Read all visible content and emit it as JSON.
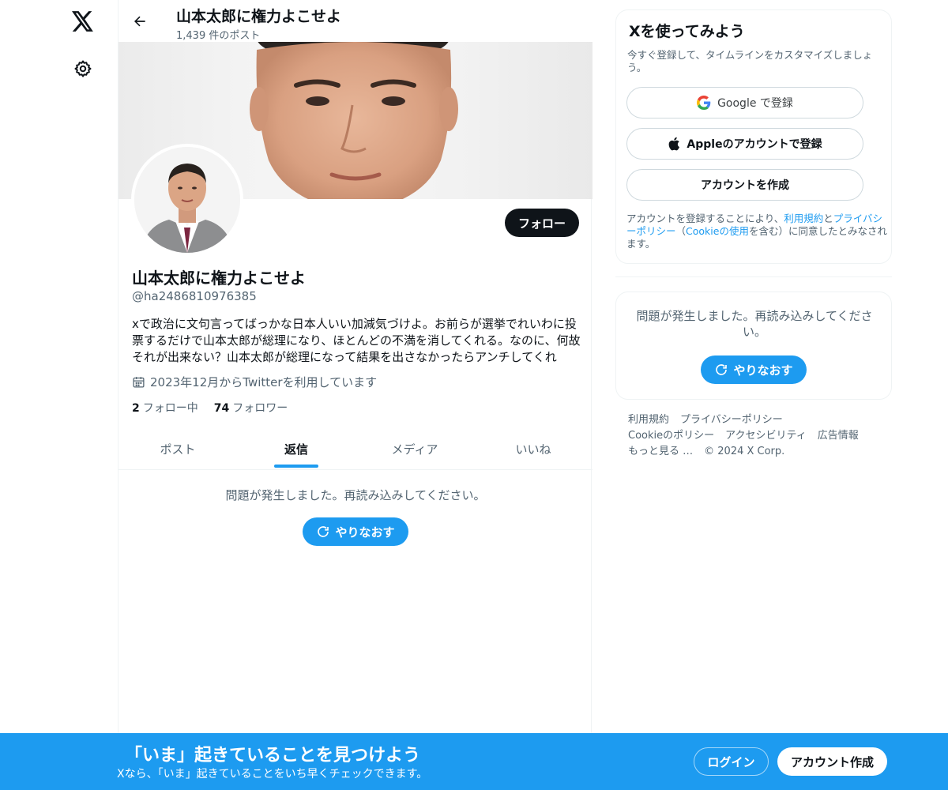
{
  "header": {
    "title": "山本太郎に権力よこせよ",
    "post_count": "1,439 件のポスト"
  },
  "profile": {
    "name": "山本太郎に権力よこせよ",
    "handle": "@ha2486810976385",
    "bio": "xで政治に文句言ってばっかな日本人いい加減気づけよ。お前らが選挙でれいわに投票するだけで山本太郎が総理になり、ほとんどの不満を消してくれる。なのに、何故それが出来ない？山本太郎が総理になって結果を出さなかったらアンチしてくれ",
    "joined": "2023年12月からTwitterを利用しています",
    "following_count": "2",
    "following_label": "フォロー中",
    "followers_count": "74",
    "followers_label": "フォロワー",
    "follow_label": "フォロー"
  },
  "tabs": [
    {
      "label": "ポスト",
      "active": false
    },
    {
      "label": "返信",
      "active": true
    },
    {
      "label": "メディア",
      "active": false
    },
    {
      "label": "いいね",
      "active": false
    }
  ],
  "feed": {
    "error_message": "問題が発生しました。再読み込みしてください。",
    "retry_label": "やりなおす"
  },
  "signup": {
    "title": "Xを使ってみよう",
    "description": "今すぐ登録して、タイムラインをカスタマイズしましょう。",
    "google_label": "Google で登録",
    "apple_label": "Appleのアカウントで登録",
    "create_label": "アカウントを作成",
    "legal_prefix": "アカウントを登録することにより、",
    "legal_terms": "利用規約",
    "legal_and": "と",
    "legal_privacy": "プライバシーポリシー",
    "legal_open": "（",
    "legal_cookie": "Cookieの使用",
    "legal_suffix": "を含む）に同意したとみなされます。"
  },
  "side_error": {
    "message": "問題が発生しました。再読み込みしてください。",
    "retry_label": "やりなおす"
  },
  "footer": {
    "links": [
      "利用規約",
      "プライバシーポリシー",
      "Cookieのポリシー",
      "アクセシビリティ",
      "広告情報",
      "もっと見る …"
    ],
    "copyright": "© 2024 X Corp."
  },
  "bottom_bar": {
    "headline": "「いま」起きていることを見つけよう",
    "subtext": "Xなら、「いま」起きていることをいち早くチェックできます。",
    "login_label": "ログイン",
    "create_label": "アカウント作成"
  },
  "colors": {
    "accent": "#1d9bf0",
    "text_primary": "#0f1419",
    "text_secondary": "#536471"
  },
  "icons": {
    "logo": "x-logo-icon",
    "settings": "gear-icon",
    "back": "arrow-left-icon",
    "calendar": "calendar-icon",
    "google": "google-g-icon",
    "apple": "apple-icon",
    "retry": "refresh-icon"
  }
}
